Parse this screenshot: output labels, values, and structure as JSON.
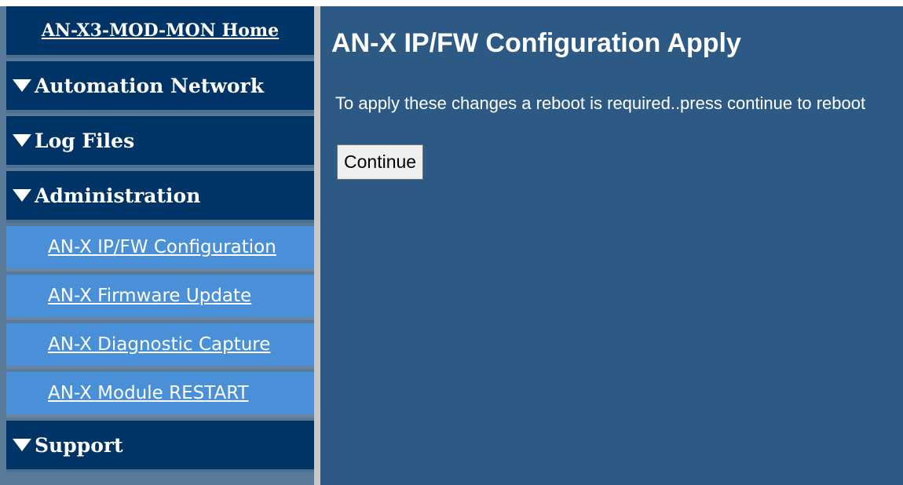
{
  "sidebar": {
    "home_label": "AN-X3-MOD-MON Home",
    "sections": [
      {
        "label": "Automation Network"
      },
      {
        "label": "Log Files"
      },
      {
        "label": "Administration"
      },
      {
        "label": "Support"
      }
    ],
    "admin_items": [
      {
        "label": "AN-X IP/FW Configuration"
      },
      {
        "label": "AN-X Firmware Update"
      },
      {
        "label": "AN-X Diagnostic Capture"
      },
      {
        "label": "AN-X Module RESTART"
      }
    ]
  },
  "main": {
    "title": "AN-X IP/FW Configuration Apply",
    "message": "To apply these changes a reboot is required..press continue to reboot",
    "continue_label": "Continue"
  },
  "colors": {
    "sidebar_header_bg": "#003366",
    "sidebar_sub_bg": "#4a90d9",
    "main_bg": "#2d5a85"
  }
}
